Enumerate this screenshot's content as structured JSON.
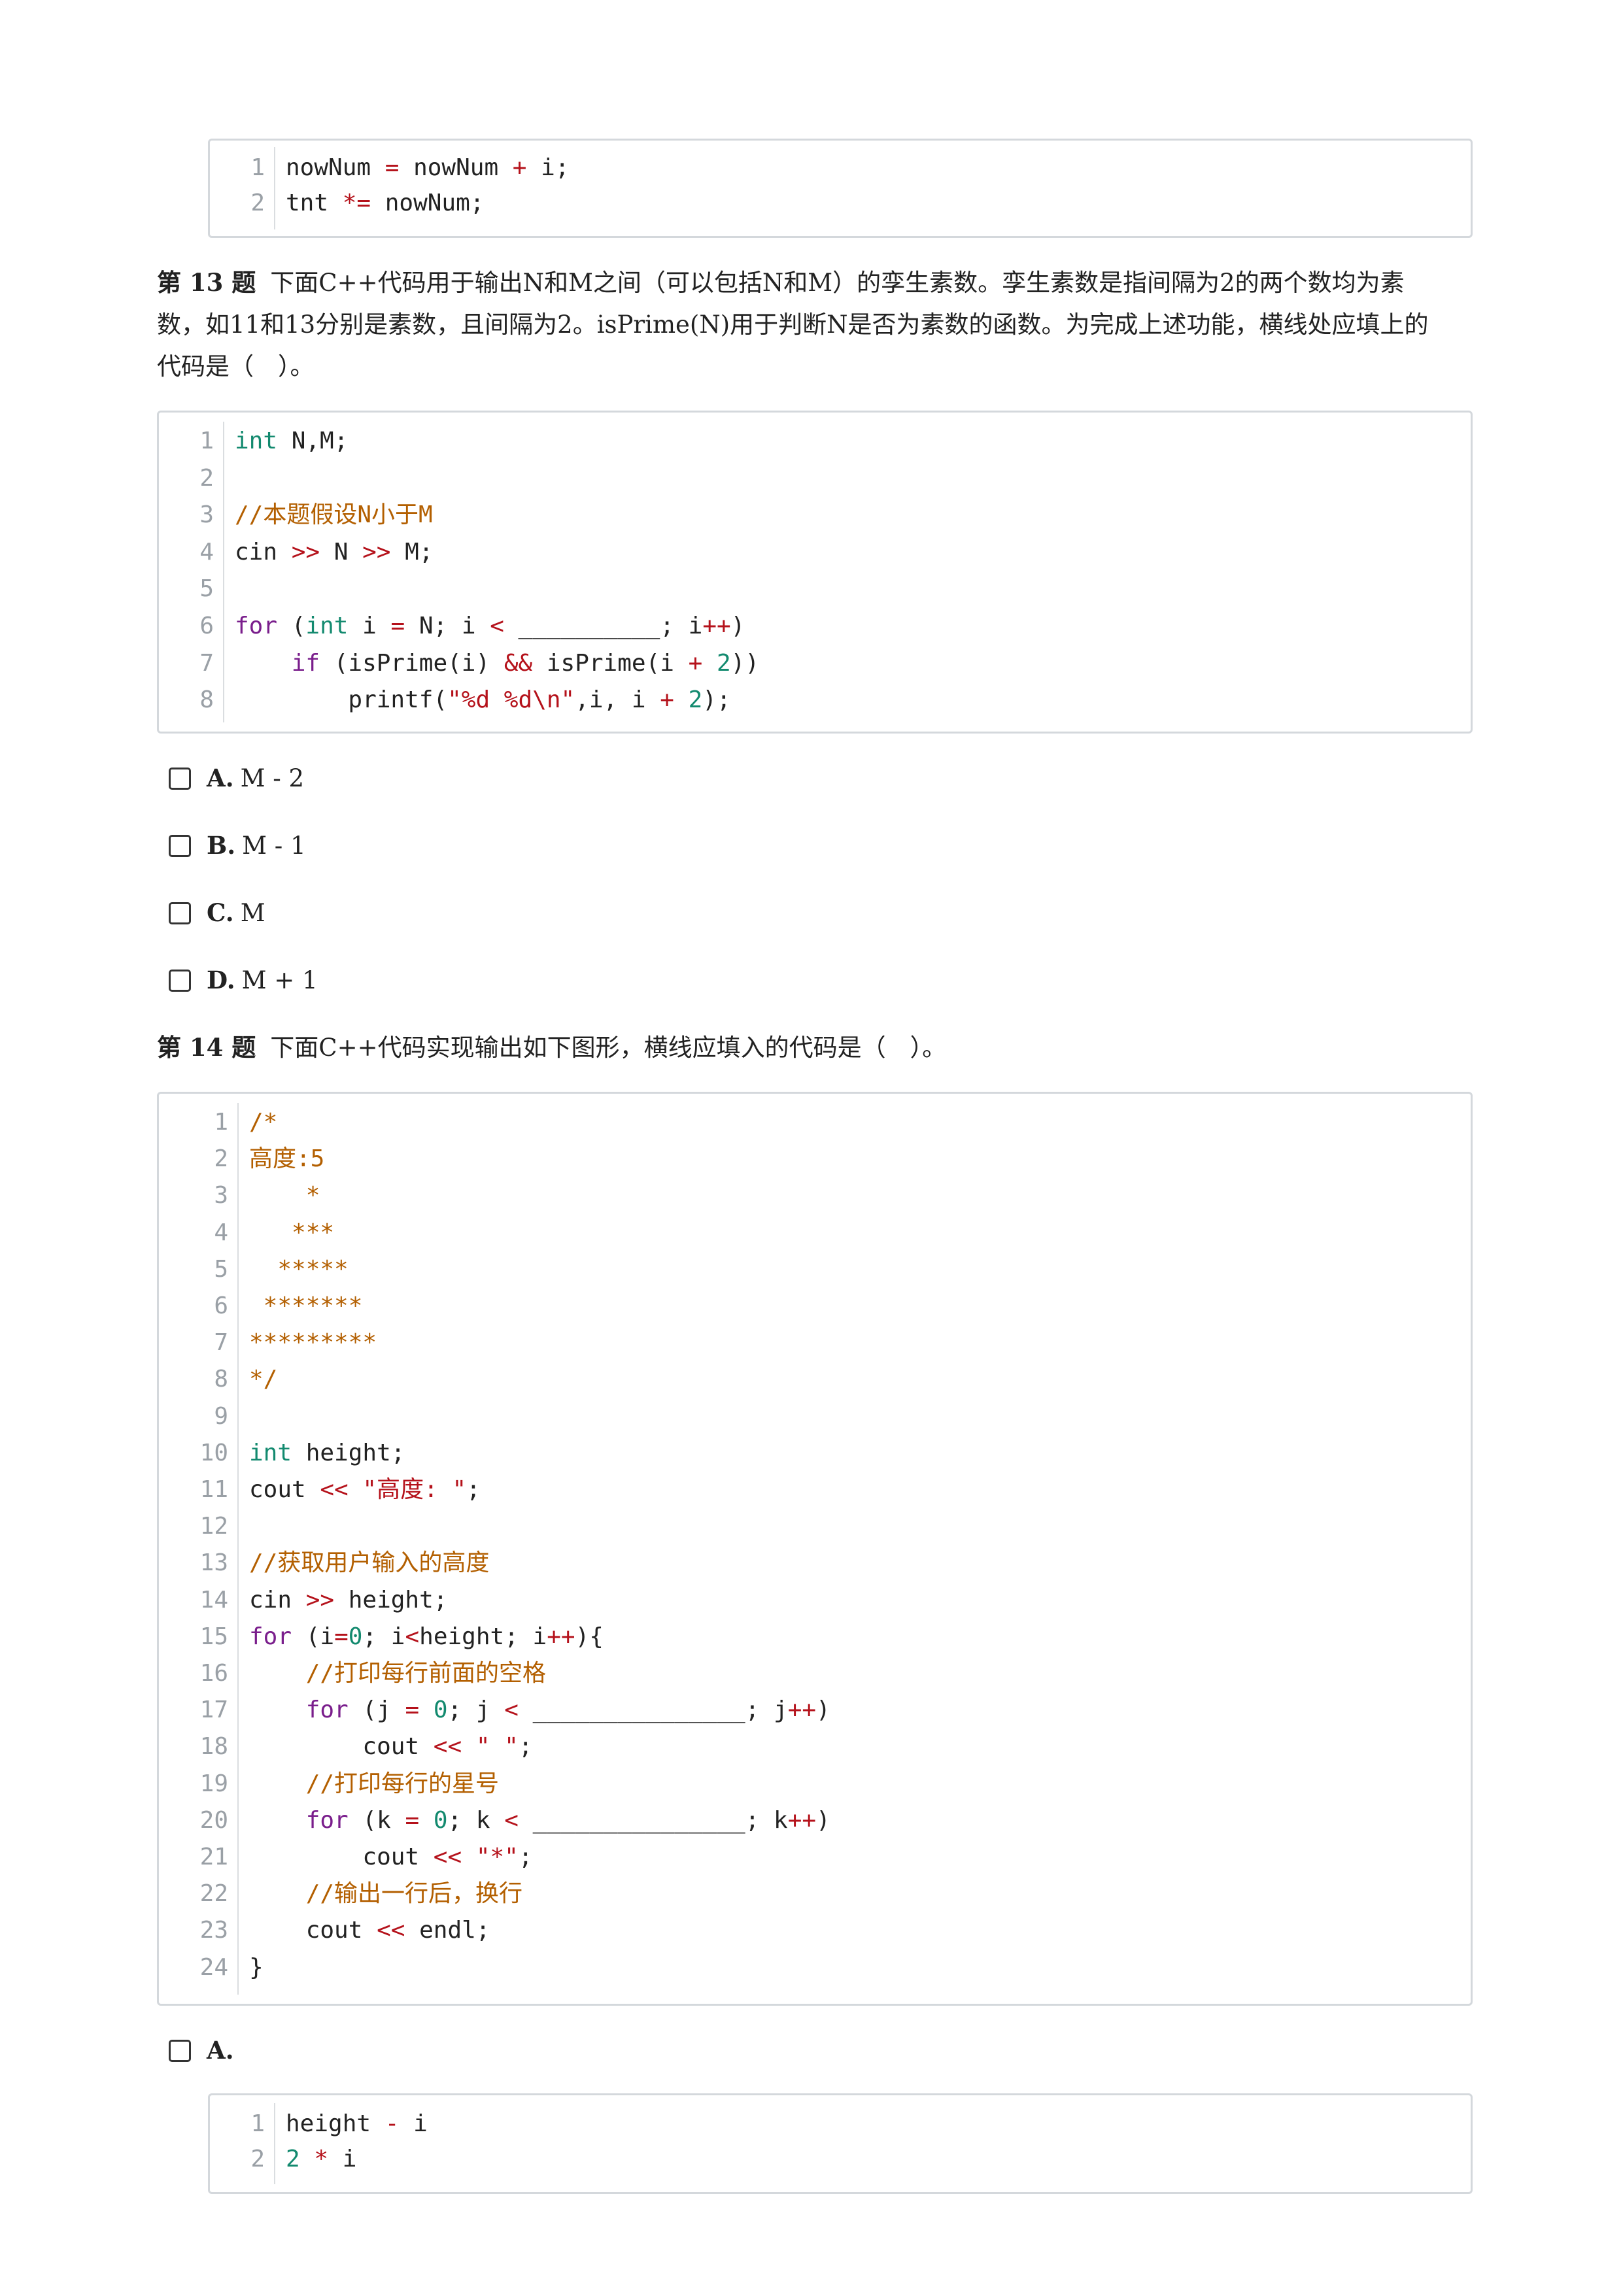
{
  "top_code": {
    "lines": [
      {
        "n": "1",
        "parts": [
          [
            "",
            "nowNum "
          ],
          [
            "op",
            "="
          ],
          [
            "",
            " nowNum "
          ],
          [
            "op",
            "+"
          ],
          [
            "",
            " i;"
          ]
        ]
      },
      {
        "n": "2",
        "parts": [
          [
            "",
            "tnt "
          ],
          [
            "op",
            "*="
          ],
          [
            "",
            " nowNum;"
          ]
        ]
      }
    ]
  },
  "q13": {
    "number": "第 13 题",
    "text_lines": [
      "下面C++代码用于输出N和M之间（可以包括N和M）的孪生素数。孪生素数是指间隔为2的两个数均为素",
      "数，如11和13分别是素数，且间隔为2。isPrime(N)用于判断N是否为素数的函数。为完成上述功能，横线处应填上的",
      "代码是（　）。"
    ],
    "code": [
      {
        "n": "1",
        "parts": [
          [
            "ty",
            "int"
          ],
          [
            "",
            " N,M;"
          ]
        ]
      },
      {
        "n": "2",
        "parts": []
      },
      {
        "n": "3",
        "parts": [
          [
            "cm",
            "//本题假设N小于M"
          ]
        ]
      },
      {
        "n": "4",
        "parts": [
          [
            "",
            "cin "
          ],
          [
            "op",
            ">>"
          ],
          [
            "",
            " N "
          ],
          [
            "op",
            ">>"
          ],
          [
            "",
            " M;"
          ]
        ]
      },
      {
        "n": "5",
        "parts": []
      },
      {
        "n": "6",
        "parts": [
          [
            "kw",
            "for"
          ],
          [
            "",
            " ("
          ],
          [
            "ty",
            "int"
          ],
          [
            "",
            " i "
          ],
          [
            "op",
            "="
          ],
          [
            "",
            " N; i "
          ],
          [
            "op",
            "<"
          ],
          [
            "",
            " __________; i"
          ],
          [
            "op",
            "++"
          ],
          [
            "",
            ")"
          ]
        ]
      },
      {
        "n": "7",
        "parts": [
          [
            "",
            "    "
          ],
          [
            "kw",
            "if"
          ],
          [
            "",
            " (isPrime(i) "
          ],
          [
            "op",
            "&&"
          ],
          [
            "",
            " isPrime(i "
          ],
          [
            "op",
            "+"
          ],
          [
            "",
            " "
          ],
          [
            "nu",
            "2"
          ],
          [
            "",
            "))"
          ]
        ]
      },
      {
        "n": "8",
        "parts": [
          [
            "",
            "        printf("
          ],
          [
            "st",
            "\"%d %d\\n\""
          ],
          [
            "",
            ",i, i "
          ],
          [
            "op",
            "+"
          ],
          [
            "",
            " "
          ],
          [
            "nu",
            "2"
          ],
          [
            "",
            ");"
          ]
        ]
      }
    ],
    "options": [
      {
        "letter": "A.",
        "text": "M - 2"
      },
      {
        "letter": "B.",
        "text": "M - 1"
      },
      {
        "letter": "C.",
        "text": "M"
      },
      {
        "letter": "D.",
        "text": "M + 1"
      }
    ]
  },
  "q14": {
    "number": "第 14 题",
    "text": "下面C++代码实现输出如下图形，横线应填入的代码是（　）。",
    "code": [
      {
        "n": "1",
        "parts": [
          [
            "cm",
            "/*"
          ]
        ]
      },
      {
        "n": "2",
        "parts": [
          [
            "cm",
            "高度:5"
          ]
        ]
      },
      {
        "n": "3",
        "parts": [
          [
            "cm",
            "    *"
          ]
        ]
      },
      {
        "n": "4",
        "parts": [
          [
            "cm",
            "   ***"
          ]
        ]
      },
      {
        "n": "5",
        "parts": [
          [
            "cm",
            "  *****"
          ]
        ]
      },
      {
        "n": "6",
        "parts": [
          [
            "cm",
            " *******"
          ]
        ]
      },
      {
        "n": "7",
        "parts": [
          [
            "cm",
            "*********"
          ]
        ]
      },
      {
        "n": "8",
        "parts": [
          [
            "cm",
            "*/"
          ]
        ]
      },
      {
        "n": "9",
        "parts": []
      },
      {
        "n": "10",
        "parts": [
          [
            "ty",
            "int"
          ],
          [
            "",
            " height;"
          ]
        ]
      },
      {
        "n": "11",
        "parts": [
          [
            "",
            "cout "
          ],
          [
            "op",
            "<<"
          ],
          [
            "",
            " "
          ],
          [
            "st",
            "\"高度: \""
          ],
          [
            "",
            ";"
          ]
        ]
      },
      {
        "n": "12",
        "parts": []
      },
      {
        "n": "13",
        "parts": [
          [
            "cm",
            "//获取用户输入的高度"
          ]
        ]
      },
      {
        "n": "14",
        "parts": [
          [
            "",
            "cin "
          ],
          [
            "op",
            ">>"
          ],
          [
            "",
            " height;"
          ]
        ]
      },
      {
        "n": "15",
        "parts": [
          [
            "kw",
            "for"
          ],
          [
            "",
            " (i"
          ],
          [
            "op",
            "="
          ],
          [
            "nu",
            "0"
          ],
          [
            "",
            "; i"
          ],
          [
            "op",
            "<"
          ],
          [
            "",
            "height; i"
          ],
          [
            "op",
            "++"
          ],
          [
            "",
            "){"
          ]
        ]
      },
      {
        "n": "16",
        "parts": [
          [
            "",
            "    "
          ],
          [
            "cm",
            "//打印每行前面的空格"
          ]
        ]
      },
      {
        "n": "17",
        "parts": [
          [
            "",
            "    "
          ],
          [
            "kw",
            "for"
          ],
          [
            "",
            " (j "
          ],
          [
            "op",
            "="
          ],
          [
            "",
            " "
          ],
          [
            "nu",
            "0"
          ],
          [
            "",
            "; j "
          ],
          [
            "op",
            "<"
          ],
          [
            "",
            " _______________; j"
          ],
          [
            "op",
            "++"
          ],
          [
            "",
            ")"
          ]
        ]
      },
      {
        "n": "18",
        "parts": [
          [
            "",
            "        cout "
          ],
          [
            "op",
            "<<"
          ],
          [
            "",
            " "
          ],
          [
            "st",
            "\" \""
          ],
          [
            "",
            ";"
          ]
        ]
      },
      {
        "n": "19",
        "parts": [
          [
            "",
            "    "
          ],
          [
            "cm",
            "//打印每行的星号"
          ]
        ]
      },
      {
        "n": "20",
        "parts": [
          [
            "",
            "    "
          ],
          [
            "kw",
            "for"
          ],
          [
            "",
            " (k "
          ],
          [
            "op",
            "="
          ],
          [
            "",
            " "
          ],
          [
            "nu",
            "0"
          ],
          [
            "",
            "; k "
          ],
          [
            "op",
            "<"
          ],
          [
            "",
            " _______________; k"
          ],
          [
            "op",
            "++"
          ],
          [
            "",
            ")"
          ]
        ]
      },
      {
        "n": "21",
        "parts": [
          [
            "",
            "        cout "
          ],
          [
            "op",
            "<<"
          ],
          [
            "",
            " "
          ],
          [
            "st",
            "\"*\""
          ],
          [
            "",
            ";"
          ]
        ]
      },
      {
        "n": "22",
        "parts": [
          [
            "",
            "    "
          ],
          [
            "cm",
            "//输出一行后，换行"
          ]
        ]
      },
      {
        "n": "23",
        "parts": [
          [
            "",
            "    cout "
          ],
          [
            "op",
            "<<"
          ],
          [
            "",
            " endl;"
          ]
        ]
      },
      {
        "n": "24",
        "parts": [
          [
            "",
            "}"
          ]
        ]
      }
    ],
    "option_a": {
      "letter": "A."
    },
    "option_a_code": [
      {
        "n": "1",
        "parts": [
          [
            "",
            "height "
          ],
          [
            "op",
            "-"
          ],
          [
            "",
            " i"
          ]
        ]
      },
      {
        "n": "2",
        "parts": [
          [
            "nu",
            "2"
          ],
          [
            "",
            " "
          ],
          [
            "op",
            "*"
          ],
          [
            "",
            " i"
          ]
        ]
      }
    ]
  }
}
